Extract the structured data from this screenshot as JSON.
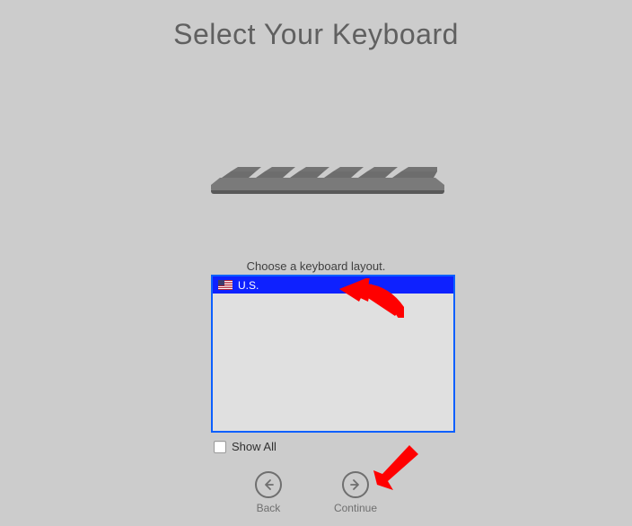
{
  "header": {
    "title": "Select Your Keyboard"
  },
  "instruction": "Choose a keyboard layout.",
  "list": {
    "items": [
      {
        "label": "U.S.",
        "flag": "us",
        "selected": true
      }
    ]
  },
  "showAll": {
    "label": "Show All",
    "checked": false
  },
  "nav": {
    "back_label": "Back",
    "continue_label": "Continue"
  }
}
